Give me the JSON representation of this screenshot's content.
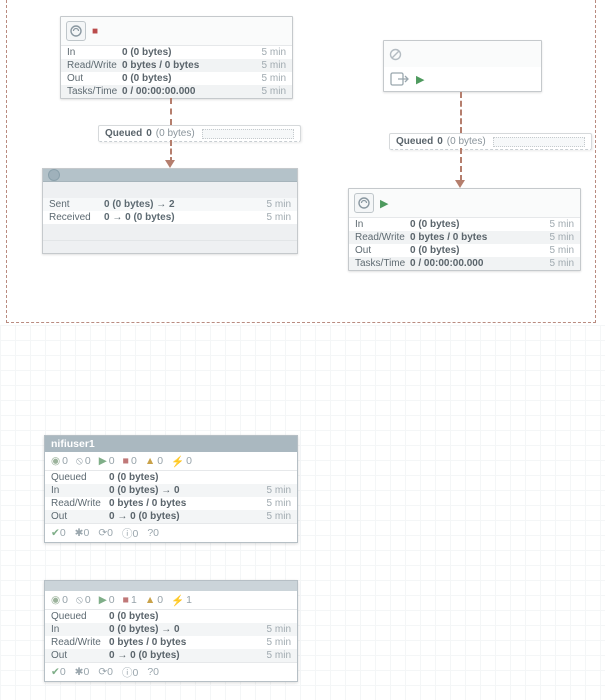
{
  "time_label": "5 min",
  "queue_label": "Queued",
  "proc1": {
    "status": "stopped",
    "rows": {
      "in": {
        "label": "In",
        "val": "0 (0 bytes)",
        "time": "5 min"
      },
      "rw": {
        "label": "Read/Write",
        "val": "0 bytes / 0 bytes",
        "time": "5 min"
      },
      "out": {
        "label": "Out",
        "val": "0 (0 bytes)",
        "time": "5 min"
      },
      "task": {
        "label": "Tasks/Time",
        "val": "0 / 00:00:00.000",
        "time": "5 min"
      }
    }
  },
  "port1": {
    "status": "disabled"
  },
  "queue1": {
    "count": "0",
    "bytes": "(0 bytes)"
  },
  "queue2": {
    "count": "0",
    "bytes": "(0 bytes)"
  },
  "rpg1": {
    "sent": {
      "label": "Sent",
      "val": "0 (0 bytes) → 2",
      "time": "5 min"
    },
    "received": {
      "label": "Received",
      "val": "0 → 0 (0 bytes)",
      "time": "5 min"
    }
  },
  "proc2": {
    "status": "running",
    "rows": {
      "in": {
        "label": "In",
        "val": "0 (0 bytes)",
        "time": "5 min"
      },
      "rw": {
        "label": "Read/Write",
        "val": "0 bytes / 0 bytes",
        "time": "5 min"
      },
      "out": {
        "label": "Out",
        "val": "0 (0 bytes)",
        "time": "5 min"
      },
      "task": {
        "label": "Tasks/Time",
        "val": "0 / 00:00:00.000",
        "time": "5 min"
      }
    }
  },
  "pg1": {
    "title": "nifiuser1",
    "status": {
      "transmitting": "0",
      "not_transmitting": "0",
      "running": "0",
      "stopped": "0",
      "invalid": "0",
      "disabled": "0"
    },
    "rows": {
      "queued": {
        "label": "Queued",
        "val": "0 (0 bytes)"
      },
      "in": {
        "label": "In",
        "val": "0 (0 bytes) → 0",
        "time": "5 min"
      },
      "rw": {
        "label": "Read/Write",
        "val": "0 bytes / 0 bytes",
        "time": "5 min"
      },
      "out": {
        "label": "Out",
        "val": "0 → 0 (0 bytes)",
        "time": "5 min"
      }
    },
    "foot": {
      "uptodate": "0",
      "locally_mod": "0",
      "stale": "0",
      "sync_fail": "0",
      "unknown": "0"
    }
  },
  "pg2": {
    "title": "",
    "status": {
      "transmitting": "0",
      "not_transmitting": "0",
      "running": "0",
      "stopped": "1",
      "invalid": "0",
      "disabled": "1"
    },
    "rows": {
      "queued": {
        "label": "Queued",
        "val": "0 (0 bytes)"
      },
      "in": {
        "label": "In",
        "val": "0 (0 bytes) → 0",
        "time": "5 min"
      },
      "rw": {
        "label": "Read/Write",
        "val": "0 bytes / 0 bytes",
        "time": "5 min"
      },
      "out": {
        "label": "Out",
        "val": "0 → 0 (0 bytes)",
        "time": "5 min"
      }
    },
    "foot": {
      "uptodate": "0",
      "locally_mod": "0",
      "stale": "0",
      "sync_fail": "0",
      "unknown": "0"
    }
  }
}
